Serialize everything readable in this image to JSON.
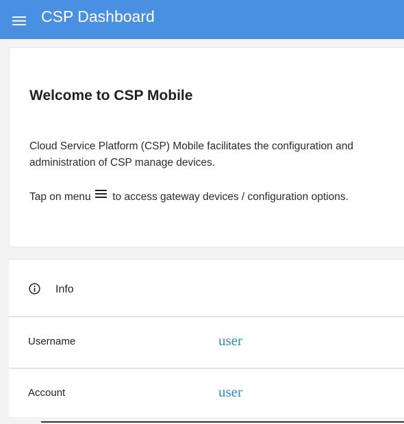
{
  "app_bar": {
    "title": "CSP Dashboard",
    "menu_icon": "hamburger-menu-icon",
    "background_color": "#4a90e2"
  },
  "welcome": {
    "title": "Welcome to CSP Mobile",
    "description": "Cloud Service Platform (CSP) Mobile facilitates the configuration and administration of CSP manage devices.",
    "tap_prefix": "Tap on menu",
    "tap_suffix": "to access gateway devices / configuration options.",
    "inline_icon": "hamburger-menu-icon"
  },
  "info": {
    "icon": "info-circle-icon",
    "label": "Info",
    "rows": [
      {
        "label": "Username",
        "value": "user"
      },
      {
        "label": "Account",
        "value": "user"
      }
    ],
    "value_color": "#2a8cc7"
  }
}
